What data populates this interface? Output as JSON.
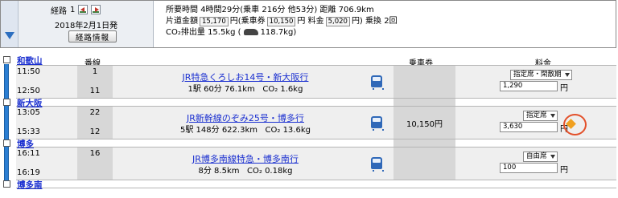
{
  "header": {
    "route_label": "経路",
    "route_number": "1",
    "departure_date": "2018年2月1日発",
    "detail_button": "経路情報",
    "summary": {
      "time_label": "所要時間",
      "time_value": "4時間29分",
      "time_note": "(乗車 216分 他53分)",
      "distance_label": "距離",
      "distance_value": "706.9km",
      "oneway_label": "片道金額",
      "oneway_value": "15,170",
      "yen": "円",
      "ticket_label": "(乗車券",
      "ticket_value": "10,150",
      "ticket_yen": "円",
      "surcharge_label": "料金",
      "surcharge_value": "5,020",
      "surcharge_yen": "円)",
      "transfers_label": "乗換",
      "transfers_value": "2回",
      "co2_label": "CO₂排出量",
      "co2_value": "15.5kg",
      "co2_car_value": "118.7kg"
    }
  },
  "columns": {
    "platform": "番線",
    "ticket": "乗車券",
    "fare": "料金"
  },
  "stations": [
    "和歌山",
    "新大阪",
    "博多",
    "博多南"
  ],
  "segments": [
    {
      "dep_time": "11:50",
      "arr_time": "12:50",
      "dep_platform": "1",
      "arr_platform": "11",
      "train": "JR特急くろしお14号・新大阪行",
      "details": "1駅 60分 76.1km",
      "co2": "CO₂ 1.6kg",
      "seat_type": "指定席・閑散期",
      "fare_value": "1,290",
      "yen": "円"
    },
    {
      "dep_time": "13:05",
      "arr_time": "15:33",
      "dep_platform": "22",
      "arr_platform": "12",
      "train": "JR新幹線のぞみ25号・博多行",
      "details": "5駅 148分 622.3km",
      "co2": "CO₂ 13.6kg",
      "ticket_fare": "10,150円",
      "seat_type": "指定席",
      "fare_value": "3,630",
      "yen": "円"
    },
    {
      "dep_time": "16:11",
      "arr_time": "16:19",
      "dep_platform": "16",
      "arr_platform": "",
      "train": "JR博多南線特急・博多南行",
      "details": "8分 8.5km",
      "co2": "CO₂ 0.18kg",
      "seat_type": "自由席",
      "fare_value": "100",
      "yen": "円"
    }
  ]
}
